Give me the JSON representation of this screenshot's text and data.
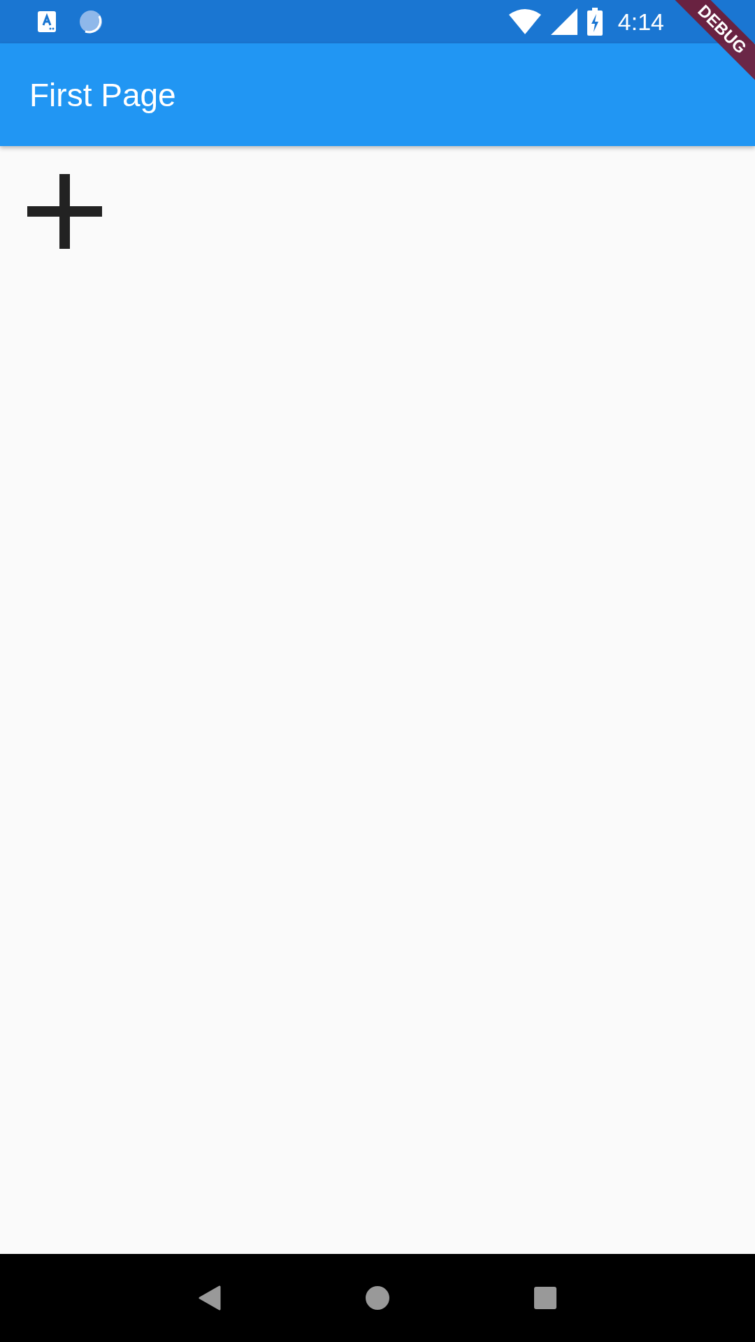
{
  "status_bar": {
    "time": "4:14"
  },
  "app_bar": {
    "title": "First Page"
  },
  "debug_banner": {
    "label": "DEBUG"
  }
}
